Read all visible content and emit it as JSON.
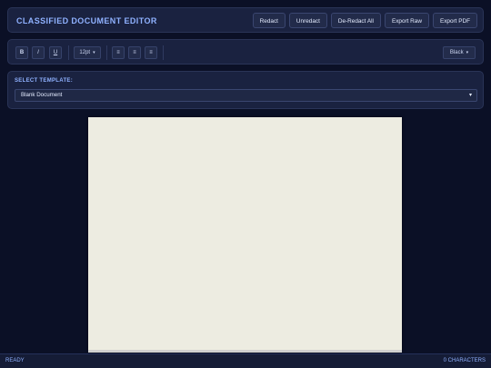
{
  "header": {
    "title": "CLASSIFIED DOCUMENT EDITOR",
    "buttons": [
      "Redact",
      "Unredact",
      "De-Redact All",
      "Export Raw",
      "Export PDF"
    ]
  },
  "toolbar": {
    "bold": "B",
    "italic": "I",
    "underline": "U",
    "font_size": "12pt",
    "align_left": "≡",
    "align_center": "≡",
    "align_right": "≡",
    "color": "Black"
  },
  "template": {
    "label": "SELECT TEMPLATE:",
    "selected": "Blank Document"
  },
  "status": {
    "left": "READY",
    "right": "0 CHARACTERS"
  },
  "colors": {
    "background": "#0b1026",
    "panel": "#1a2240",
    "accent": "#8fb1ff",
    "page": "#edece1"
  }
}
